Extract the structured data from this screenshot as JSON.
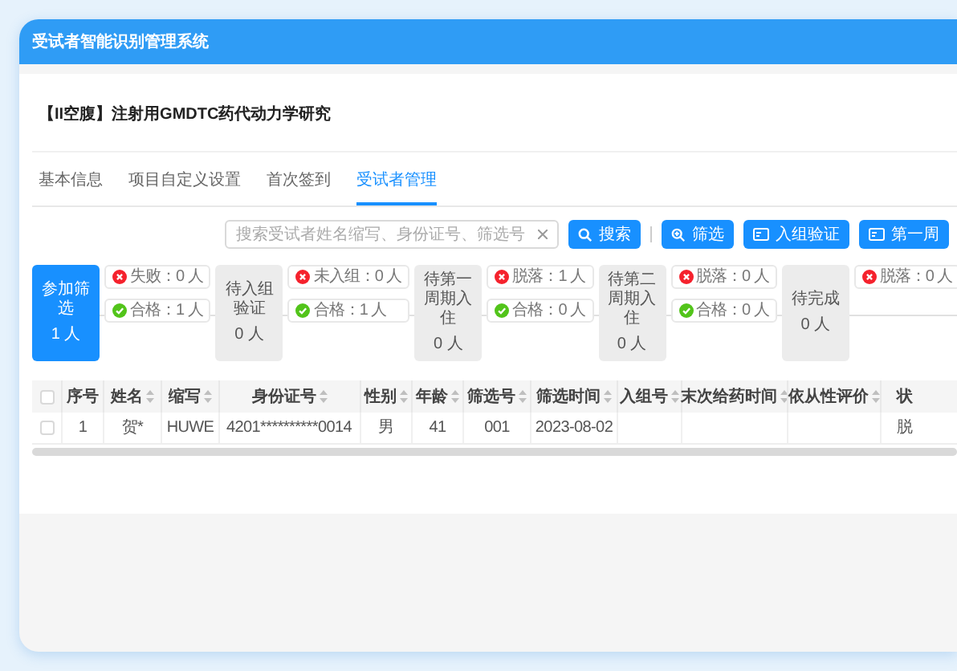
{
  "header": {
    "title": "受试者智能识别管理系统"
  },
  "project_title": "【II空腹】注射用GMDTC药代动力学研究",
  "tabs": [
    {
      "label": "基本信息",
      "selected": false
    },
    {
      "label": "项目自定义设置",
      "selected": false
    },
    {
      "label": "首次签到",
      "selected": false
    },
    {
      "label": "受试者管理",
      "selected": true
    }
  ],
  "toolbar": {
    "search": {
      "placeholder": "搜索受试者姓名缩写、身份证号、筛选号"
    },
    "buttons": [
      {
        "label": "搜索",
        "kind": "search"
      },
      {
        "label": "筛选",
        "kind": "filter"
      },
      {
        "label": "入组验证",
        "kind": "card"
      },
      {
        "label": "第一周",
        "kind": "card"
      }
    ]
  },
  "flow": [
    {
      "name": "参加筛选",
      "count": "1 人",
      "selected": true,
      "outcomes": [
        {
          "kind": "fail",
          "text": "失败：0 人"
        },
        {
          "kind": "pass",
          "text": "合格：1 人"
        }
      ]
    },
    {
      "name": "待入组验证",
      "count": "0 人",
      "selected": false,
      "outcomes": [
        {
          "kind": "fail",
          "text": "未入组：0 人"
        },
        {
          "kind": "pass",
          "text": "合格：1 人"
        }
      ]
    },
    {
      "name": "待第一周期入住",
      "count": "0 人",
      "selected": false,
      "outcomes": [
        {
          "kind": "fail",
          "text": "脱落：1 人"
        },
        {
          "kind": "pass",
          "text": "合格：0 人"
        }
      ]
    },
    {
      "name": "待第二周期入住",
      "count": "0 人",
      "selected": false,
      "outcomes": [
        {
          "kind": "fail",
          "text": "脱落：0 人"
        },
        {
          "kind": "pass",
          "text": "合格：0 人"
        }
      ]
    },
    {
      "name": "待完成",
      "count": "0 人",
      "selected": false,
      "outcomes": [
        {
          "kind": "fail",
          "text": "脱落：0 人"
        }
      ]
    }
  ],
  "table": {
    "header_checked": false,
    "columns": [
      {
        "label": "序号",
        "sortable": false
      },
      {
        "label": "姓名",
        "sortable": true
      },
      {
        "label": "缩写",
        "sortable": true
      },
      {
        "label": "身份证号",
        "sortable": true
      },
      {
        "label": "性别",
        "sortable": true
      },
      {
        "label": "年龄",
        "sortable": true
      },
      {
        "label": "筛选号",
        "sortable": true
      },
      {
        "label": "筛选时间",
        "sortable": true
      },
      {
        "label": "入组号",
        "sortable": true
      },
      {
        "label": "末次给药时间",
        "sortable": true
      },
      {
        "label": "依从性评价",
        "sortable": true
      },
      {
        "label": "状",
        "sortable": false
      }
    ],
    "rows": [
      {
        "checked": false,
        "cells": [
          "1",
          "贺*",
          "HUWE",
          "4201**********0014",
          "男",
          "41",
          "001",
          "2023-08-02",
          null,
          null,
          null,
          "脱"
        ]
      }
    ]
  }
}
